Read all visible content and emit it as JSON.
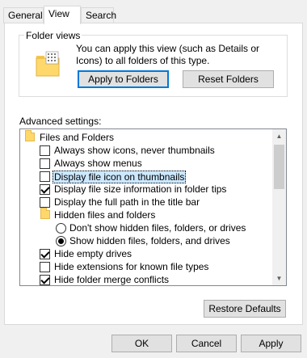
{
  "tabs": [
    {
      "label": "General"
    },
    {
      "label": "View"
    },
    {
      "label": "Search"
    }
  ],
  "folder_views": {
    "title": "Folder views",
    "description": "You can apply this view (such as Details or Icons) to all folders of this type.",
    "apply_label": "Apply to Folders",
    "reset_label": "Reset Folders"
  },
  "advanced": {
    "label": "Advanced settings:",
    "items": [
      {
        "type": "folder",
        "label": "Files and Folders"
      },
      {
        "type": "checkbox",
        "checked": false,
        "label": "Always show icons, never thumbnails"
      },
      {
        "type": "checkbox",
        "checked": false,
        "label": "Always show menus"
      },
      {
        "type": "checkbox",
        "checked": false,
        "label": "Display file icon on thumbnails"
      },
      {
        "type": "checkbox",
        "checked": true,
        "label": "Display file size information in folder tips"
      },
      {
        "type": "checkbox",
        "checked": false,
        "label": "Display the full path in the title bar"
      },
      {
        "type": "folder",
        "label": "Hidden files and folders"
      },
      {
        "type": "radio",
        "checked": false,
        "label": "Don't show hidden files, folders, or drives"
      },
      {
        "type": "radio",
        "checked": true,
        "label": "Show hidden files, folders, and drives"
      },
      {
        "type": "checkbox",
        "checked": true,
        "label": "Hide empty drives"
      },
      {
        "type": "checkbox",
        "checked": false,
        "label": "Hide extensions for known file types"
      },
      {
        "type": "checkbox",
        "checked": true,
        "label": "Hide folder merge conflicts"
      }
    ]
  },
  "restore_label": "Restore Defaults",
  "footer": {
    "ok_label": "OK",
    "cancel_label": "Cancel",
    "apply_label": "Apply"
  }
}
